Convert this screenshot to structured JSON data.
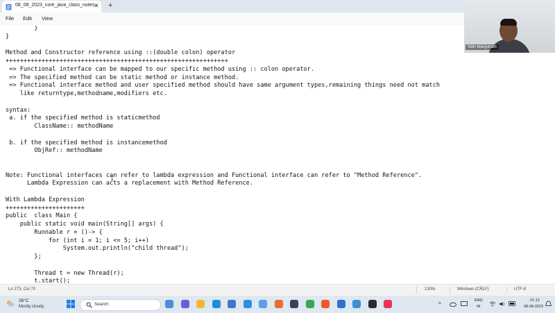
{
  "window": {
    "tab_title": "08_08_2023_core_java_class_notes",
    "tab_close": "✕",
    "new_tab": "+"
  },
  "menu": {
    "items": [
      "File",
      "Edit",
      "View"
    ]
  },
  "editor": {
    "lines": [
      "        }",
      "}",
      "",
      "Method and Constructor reference using ::(double colon) operator",
      "++++++++++++++++++++++++++++++++++++++++++++++++++++++++++++++",
      " => Functional interface can be mapped to our specific method using :: colon operator.",
      " => The specified method can be static method or instance method.",
      " => Functional interface method and user specified method should have same argument types,remaining things need not match",
      "    like returntype,methodname,modifiers etc.",
      "",
      "syntax:",
      " a. if the specified method is staticmethod",
      "        ClassName:: methodName",
      "",
      " b. if the specified method is instancemethod",
      "        ObjRef:: methodName",
      "",
      "",
      "Note: Functional interfaces can refer to lambda expression and Functional interface can refer to \"Method Reference\".",
      "      Lambda Expression can acts a replacement with Method Reference.",
      "",
      "With Lambda Expression",
      "++++++++++++++++++++++",
      "public  class Main {",
      "    public static void main(String[] args) {",
      "        Runnable r = ()-> {",
      "            for (int i = 1; i <= 5; i++)",
      "                System.out.println(\"child thread\");",
      "        };",
      "",
      "        Thread t = new Thread(r);",
      "        t.start();"
    ],
    "caret": "I"
  },
  "webcam": {
    "name": "Nitin Manjunath"
  },
  "status": {
    "position": "Ln 273, Col 70",
    "zoom": "130%",
    "line_ending": "Windows (CRLF)",
    "encoding": "UTF-8"
  },
  "taskbar": {
    "weather_temp": "26°C",
    "weather_desc": "Mostly cloudy",
    "search_label": "Search",
    "tray_chevron": "^",
    "lang_line1": "ENG",
    "lang_line2": "IN",
    "time": "21:12",
    "date": "08-08-2023",
    "app_icons": [
      {
        "name": "widgets-icon",
        "color": "#4a90d9"
      },
      {
        "name": "meet-icon",
        "color": "#6b5fd3"
      },
      {
        "name": "file-explorer-icon",
        "color": "#f2b632"
      },
      {
        "name": "edge-icon",
        "color": "#1f8dd6"
      },
      {
        "name": "store-icon",
        "color": "#3b79c9"
      },
      {
        "name": "photos-icon",
        "color": "#2f8fdd"
      },
      {
        "name": "snipping-icon",
        "color": "#5aa0e6"
      },
      {
        "name": "firefox-icon",
        "color": "#ec6b2d"
      },
      {
        "name": "media-icon",
        "color": "#3a3f5c"
      },
      {
        "name": "chrome-icon",
        "color": "#34a853"
      },
      {
        "name": "brave-icon",
        "color": "#ef5a24"
      },
      {
        "name": "app-blue-icon",
        "color": "#2c6fd6"
      },
      {
        "name": "notepad-icon",
        "color": "#3e8ed8"
      },
      {
        "name": "terminal-icon",
        "color": "#2b2b2b"
      },
      {
        "name": "intellij-icon",
        "color": "#e8335d"
      }
    ]
  },
  "colors": {
    "tabbar": "#dfe6ee",
    "taskbar": "#dfe7f1",
    "statusbar": "#f3f3f3"
  }
}
